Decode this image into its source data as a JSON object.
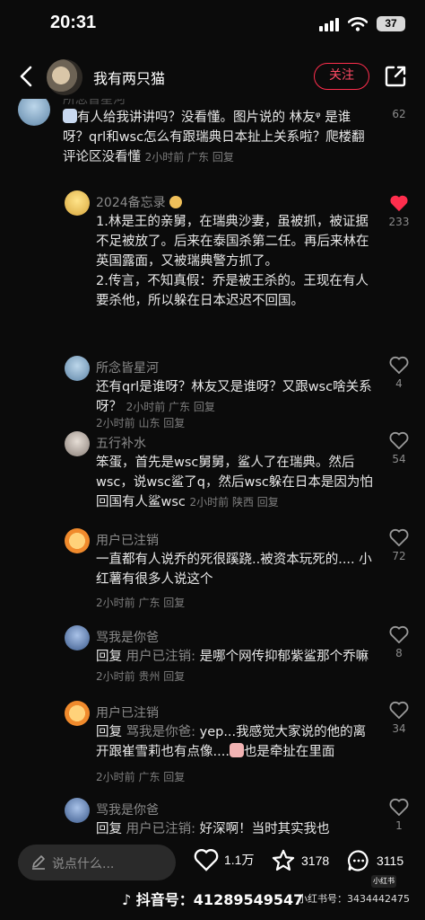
{
  "status": {
    "time": "20:31",
    "battery": "37"
  },
  "header": {
    "title": "我有两只猫",
    "follow_label": "关注"
  },
  "comments": [
    {
      "name": "所念皆星河",
      "text": "有人给我讲讲吗？没看懂。图片说的 林友ᵠ 是谁呀？qrl和wsc怎么有跟瑞典日本扯上关系啦？爬楼翻评论区没看懂",
      "meta": "2小时前 广东 回复",
      "likes": "62"
    },
    {
      "name": "2024备忘录",
      "text": "1.林是王的亲舅，在瑞典沙妻，虽被抓，被证据不足被放了。后来在泰国杀第二任。再后来林在英国露面，又被瑞典警方抓了。\n2.传言，不知真假：乔是被王杀的。王现在有人要杀他，所以躲在日本迟迟不回国。",
      "meta": "2小时前 山东 回复",
      "likes": "233"
    },
    {
      "name": "所念皆星河",
      "text": "还有qrl是谁呀？林友又是谁呀？又跟wsc啥关系呀？",
      "meta": "2小时前 广东 回复",
      "likes": "4"
    },
    {
      "name": "五行补水",
      "text": "笨蛋，首先是wsc舅舅，鲨人了在瑞典。然后wsc，说wsc鲨了q，然后wsc躲在日本是因为怕回国有人鲨wsc",
      "meta": "2小时前 陕西 回复",
      "likes": "54"
    },
    {
      "name": "用户已注销",
      "text": "一直都有人说乔的死很蹊跷..被资本玩死的.... 小红薯有很多人说这个",
      "meta": "2小时前 广东 回复",
      "likes": "72"
    },
    {
      "name": "骂我是你爸",
      "reply_label": "回复",
      "reply_to": "用户已注销:",
      "text": "是哪个网传抑郁紫鲨那个乔嘛",
      "meta": "2小时前 贵州 回复",
      "likes": "8"
    },
    {
      "name": "用户已注销",
      "reply_label": "回复",
      "reply_to": "骂我是你爸:",
      "text": "yep...我感觉大家说的他的离开跟崔雪莉也有点像....",
      "text_2": "也是牵扯在里面",
      "meta": "2小时前 广东 回复",
      "likes": "34"
    },
    {
      "name": "骂我是你爸",
      "reply_label": "回复",
      "reply_to": "用户已注销:",
      "text": "好深啊！当时其实我也",
      "likes": "1"
    }
  ],
  "bottom": {
    "input_placeholder": "说点什么...",
    "likes": "1.1万",
    "stars": "3178",
    "comments": "3115"
  },
  "watermark": {
    "douyin": "抖音号：41289549547",
    "xhs": "小红书号：3434442475",
    "xhs_badge": "小红书"
  },
  "colors": {
    "accent": "#ff2e4d",
    "background": "#0b0b0b",
    "meta": "#7d7d7d"
  }
}
